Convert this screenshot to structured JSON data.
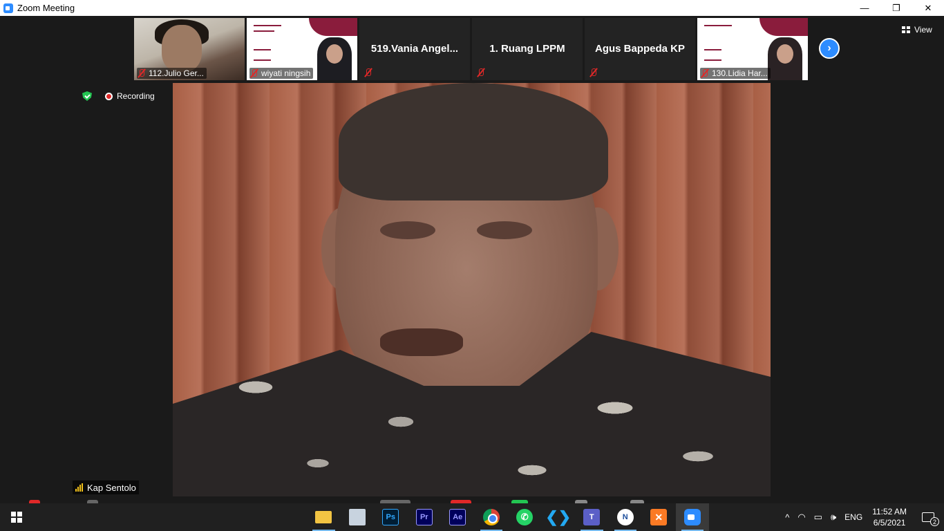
{
  "window": {
    "title": "Zoom Meeting",
    "controls": {
      "minimize": "—",
      "restore": "❐",
      "close": "✕"
    }
  },
  "strip": {
    "tiles": [
      {
        "kind": "video",
        "name": "112.Julio Ger..."
      },
      {
        "kind": "slide",
        "name": "wiyati ningsih"
      },
      {
        "kind": "name",
        "name": "519.Vania  Angel..."
      },
      {
        "kind": "name",
        "name": "1. Ruang LPPM"
      },
      {
        "kind": "name",
        "name": "Agus Bappeda KP"
      },
      {
        "kind": "slide",
        "name": "130.Lidia Har..."
      }
    ],
    "next_icon": "›"
  },
  "view_button": {
    "label": "View"
  },
  "status": {
    "recording_label": "Recording"
  },
  "speaker": {
    "name": "Kap Sentolo"
  },
  "taskbar": {
    "apps": [
      {
        "name": "file-explorer",
        "glyph": ""
      },
      {
        "name": "photos",
        "glyph": ""
      },
      {
        "name": "photoshop",
        "glyph": "Ps"
      },
      {
        "name": "premiere-pro",
        "glyph": "Pr"
      },
      {
        "name": "after-effects",
        "glyph": "Ae"
      },
      {
        "name": "chrome",
        "glyph": ""
      },
      {
        "name": "whatsapp",
        "glyph": "✆"
      },
      {
        "name": "vscode",
        "glyph": "❮❯"
      },
      {
        "name": "teams",
        "glyph": "T"
      },
      {
        "name": "microsoft-app",
        "glyph": "N"
      },
      {
        "name": "xampp",
        "glyph": "✕"
      },
      {
        "name": "zoom",
        "glyph": ""
      }
    ],
    "tray": {
      "chevron": "^",
      "language": "ENG",
      "time": "11:52 AM",
      "date": "6/5/2021",
      "notification_count": "2"
    }
  }
}
